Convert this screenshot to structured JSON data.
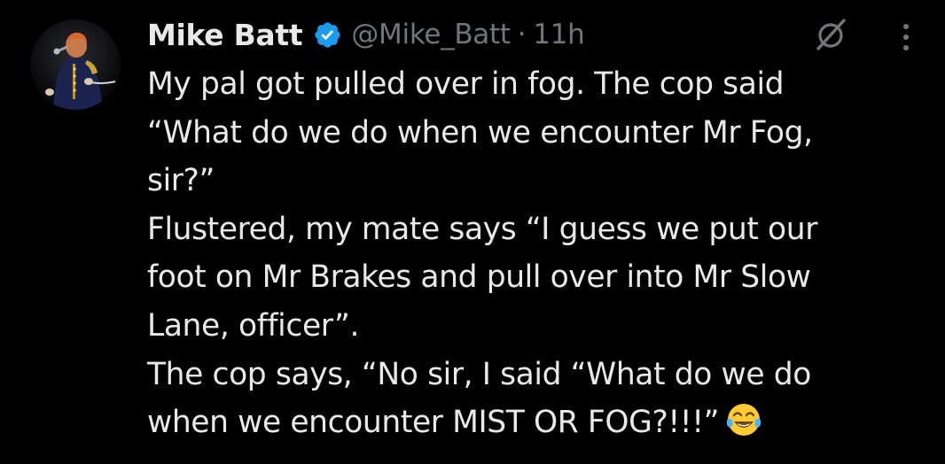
{
  "author": {
    "name": "Mike Batt",
    "handle": "@Mike_Batt",
    "separator": "·",
    "timestamp": "11h",
    "verified": true,
    "verified_color": "#1d9bf0"
  },
  "icons": {
    "avatar": "avatar-photo",
    "verified": "verified-badge-icon",
    "grok": "grok-icon",
    "more": "more-options-icon",
    "emoji": "face-with-tears-of-joy-emoji"
  },
  "tweet": {
    "lines": [
      "My pal got pulled over in fog. The cop said",
      "“What do we do when we encounter Mr Fog,",
      "sir?”",
      "Flustered, my mate says “I guess we put our",
      "foot on Mr Brakes and pull over into Mr Slow",
      "Lane, officer”.",
      "The cop says, “No sir, I said “What do we do",
      "when we encounter MIST OR FOG?!!!”"
    ]
  },
  "colors": {
    "background": "#000000",
    "text_primary": "#e7e9ea",
    "text_secondary": "#71767b"
  }
}
